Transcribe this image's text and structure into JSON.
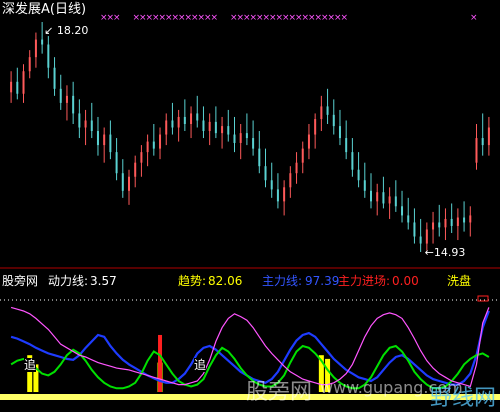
{
  "chart_data": {
    "type": "candlestick",
    "title": "深发展A(日线)",
    "price_high_label": "18.20",
    "price_low_label": "14.93",
    "price_high_marker": "↙",
    "price_low_marker": "←",
    "candles": [
      [
        17.2,
        17.5,
        17.05,
        17.35
      ],
      [
        17.35,
        17.55,
        17.1,
        17.18
      ],
      [
        17.18,
        17.6,
        17.05,
        17.5
      ],
      [
        17.5,
        17.8,
        17.4,
        17.7
      ],
      [
        17.7,
        18.05,
        17.55,
        17.95
      ],
      [
        17.95,
        18.2,
        17.75,
        17.88
      ],
      [
        17.88,
        18.0,
        17.4,
        17.55
      ],
      [
        17.55,
        17.7,
        17.15,
        17.25
      ],
      [
        17.25,
        17.45,
        16.95,
        17.05
      ],
      [
        17.05,
        17.3,
        16.8,
        17.15
      ],
      [
        17.15,
        17.35,
        16.75,
        16.9
      ],
      [
        16.9,
        17.1,
        16.55,
        16.7
      ],
      [
        16.7,
        16.95,
        16.45,
        16.8
      ],
      [
        16.8,
        17.05,
        16.55,
        16.65
      ],
      [
        16.65,
        16.85,
        16.3,
        16.45
      ],
      [
        16.45,
        16.7,
        16.2,
        16.6
      ],
      [
        16.6,
        16.8,
        16.25,
        16.35
      ],
      [
        16.35,
        16.55,
        15.95,
        16.05
      ],
      [
        16.05,
        16.25,
        15.7,
        15.8
      ],
      [
        15.8,
        16.1,
        15.6,
        16.0
      ],
      [
        16.0,
        16.3,
        15.85,
        16.2
      ],
      [
        16.2,
        16.45,
        16.0,
        16.35
      ],
      [
        16.35,
        16.6,
        16.15,
        16.5
      ],
      [
        16.5,
        16.75,
        16.3,
        16.4
      ],
      [
        16.4,
        16.7,
        16.25,
        16.6
      ],
      [
        16.6,
        16.9,
        16.45,
        16.8
      ],
      [
        16.8,
        17.05,
        16.6,
        16.7
      ],
      [
        16.7,
        16.95,
        16.5,
        16.85
      ],
      [
        16.85,
        17.1,
        16.65,
        16.75
      ],
      [
        16.75,
        17.0,
        16.55,
        16.9
      ],
      [
        16.9,
        17.15,
        16.7,
        16.8
      ],
      [
        16.8,
        17.0,
        16.55,
        16.65
      ],
      [
        16.65,
        16.9,
        16.45,
        16.78
      ],
      [
        16.78,
        17.0,
        16.55,
        16.62
      ],
      [
        16.62,
        16.85,
        16.4,
        16.72
      ],
      [
        16.72,
        16.95,
        16.5,
        16.6
      ],
      [
        16.6,
        16.85,
        16.35,
        16.48
      ],
      [
        16.48,
        16.75,
        16.25,
        16.62
      ],
      [
        16.62,
        16.9,
        16.45,
        16.55
      ],
      [
        16.55,
        16.8,
        16.3,
        16.4
      ],
      [
        16.4,
        16.65,
        16.05,
        16.15
      ],
      [
        16.15,
        16.4,
        15.85,
        15.95
      ],
      [
        15.95,
        16.2,
        15.7,
        15.82
      ],
      [
        15.82,
        16.05,
        15.55,
        15.65
      ],
      [
        15.65,
        15.95,
        15.45,
        15.85
      ],
      [
        15.85,
        16.15,
        15.7,
        16.05
      ],
      [
        16.05,
        16.35,
        15.9,
        16.2
      ],
      [
        16.2,
        16.5,
        16.05,
        16.4
      ],
      [
        16.4,
        16.75,
        16.25,
        16.6
      ],
      [
        16.6,
        16.9,
        16.4,
        16.82
      ],
      [
        16.82,
        17.15,
        16.65,
        17.0
      ],
      [
        17.0,
        17.25,
        16.75,
        16.88
      ],
      [
        16.88,
        17.1,
        16.6,
        16.72
      ],
      [
        16.72,
        16.95,
        16.45,
        16.55
      ],
      [
        16.55,
        16.8,
        16.25,
        16.35
      ],
      [
        16.35,
        16.55,
        16.0,
        16.1
      ],
      [
        16.1,
        16.35,
        15.85,
        15.95
      ],
      [
        15.95,
        16.2,
        15.7,
        15.8
      ],
      [
        15.8,
        16.05,
        15.55,
        15.65
      ],
      [
        15.65,
        15.9,
        15.45,
        15.78
      ],
      [
        15.78,
        16.0,
        15.55,
        15.62
      ],
      [
        15.62,
        15.85,
        15.4,
        15.72
      ],
      [
        15.72,
        15.95,
        15.5,
        15.58
      ],
      [
        15.58,
        15.8,
        15.35,
        15.45
      ],
      [
        15.45,
        15.7,
        15.25,
        15.35
      ],
      [
        15.35,
        15.55,
        15.05,
        15.15
      ],
      [
        15.15,
        15.4,
        14.93,
        15.05
      ],
      [
        15.05,
        15.35,
        14.95,
        15.25
      ],
      [
        15.25,
        15.5,
        15.05,
        15.35
      ],
      [
        15.35,
        15.6,
        15.15,
        15.28
      ],
      [
        15.28,
        15.55,
        15.1,
        15.4
      ],
      [
        15.4,
        15.62,
        15.2,
        15.3
      ],
      [
        15.3,
        15.55,
        15.1,
        15.42
      ],
      [
        15.42,
        15.65,
        15.22,
        15.35
      ],
      [
        15.35,
        15.58,
        15.15,
        15.45
      ],
      [
        16.2,
        16.75,
        16.1,
        16.55
      ],
      [
        16.55,
        16.9,
        16.3,
        16.45
      ],
      [
        16.45,
        16.85,
        16.3,
        16.7
      ]
    ],
    "indicator": {
      "site_label": "股旁网",
      "dynamic_label": "动力线:",
      "dynamic_value": "3.57",
      "trend_label": "趋势:",
      "trend_value": "82.06",
      "main_label": "主力线:",
      "main_value": "97.39",
      "entry_label": "主力进场:",
      "entry_value": "0.00",
      "wash_label": "洗盘",
      "zhui_marks": [
        "追",
        "追"
      ],
      "trend_values": [
        92,
        90,
        88,
        85,
        80,
        74,
        68,
        60,
        52,
        48,
        44,
        40,
        38,
        35,
        32,
        30,
        28,
        26,
        25,
        24,
        22,
        20,
        18,
        16,
        14,
        12,
        10,
        8,
        8,
        10,
        12,
        20,
        35,
        55,
        70,
        80,
        85,
        82,
        78,
        70,
        60,
        50,
        42,
        35,
        28,
        22,
        18,
        14,
        12,
        10,
        8,
        8,
        10,
        14,
        20,
        30,
        45,
        60,
        72,
        80,
        84,
        86,
        84,
        80,
        70,
        58,
        45,
        34,
        26,
        20,
        16,
        12,
        10,
        8,
        6,
        30,
        75,
        92
      ],
      "main_values": [
        60,
        58,
        55,
        52,
        48,
        45,
        42,
        40,
        38,
        36,
        35,
        40,
        48,
        55,
        62,
        60,
        50,
        42,
        35,
        30,
        26,
        22,
        18,
        15,
        12,
        10,
        10,
        14,
        20,
        30,
        42,
        48,
        50,
        46,
        40,
        34,
        28,
        22,
        18,
        14,
        12,
        10,
        14,
        22,
        34,
        46,
        56,
        62,
        64,
        60,
        52,
        44,
        36,
        30,
        24,
        20,
        16,
        14,
        12,
        16,
        24,
        32,
        38,
        40,
        36,
        30,
        24,
        18,
        14,
        12,
        10,
        8,
        8,
        12,
        20,
        40,
        70,
        88
      ],
      "dynamic_values": [
        30,
        34,
        36,
        32,
        26,
        20,
        18,
        22,
        30,
        40,
        46,
        42,
        34,
        24,
        16,
        10,
        6,
        4,
        4,
        6,
        10,
        20,
        34,
        44,
        40,
        30,
        20,
        12,
        8,
        6,
        8,
        14,
        28,
        40,
        48,
        44,
        36,
        26,
        18,
        12,
        8,
        6,
        6,
        10,
        18,
        32,
        44,
        50,
        48,
        42,
        34,
        24,
        16,
        10,
        6,
        4,
        4,
        8,
        16,
        28,
        40,
        48,
        50,
        44,
        34,
        22,
        14,
        8,
        4,
        4,
        6,
        12,
        20,
        30,
        36,
        40,
        42,
        38
      ],
      "entry_bars": [
        0,
        0,
        0,
        0,
        0,
        0,
        0,
        0,
        0,
        0,
        0,
        0,
        0,
        0,
        0,
        0,
        0,
        0,
        0,
        0,
        0,
        0,
        0,
        0,
        0,
        0,
        0,
        0,
        0,
        0,
        0,
        0,
        0,
        0,
        0,
        0,
        0,
        0,
        0,
        0,
        0,
        0,
        0,
        0,
        0,
        0,
        0,
        0,
        0,
        0,
        0,
        0,
        0,
        0,
        0,
        0,
        0,
        0,
        0,
        0,
        0,
        0,
        0,
        0,
        0,
        0,
        0,
        0,
        0,
        0,
        0,
        0,
        0,
        0,
        0,
        0,
        0,
        0
      ],
      "yellow_bars": [
        0,
        0,
        0,
        40,
        30,
        0,
        0,
        0,
        0,
        0,
        0,
        0,
        0,
        0,
        0,
        0,
        0,
        0,
        0,
        0,
        0,
        0,
        0,
        0,
        32,
        0,
        0,
        0,
        0,
        0,
        0,
        0,
        0,
        0,
        0,
        0,
        0,
        0,
        0,
        0,
        0,
        0,
        0,
        0,
        0,
        0,
        0,
        0,
        0,
        0,
        40,
        36,
        0,
        0,
        0,
        0,
        0,
        0,
        0,
        0,
        0,
        0,
        0,
        0,
        0,
        0,
        0,
        0,
        0,
        0,
        0,
        0,
        0,
        0,
        0,
        0,
        0,
        0
      ],
      "red_bars": [
        0,
        0,
        0,
        0,
        0,
        0,
        0,
        0,
        0,
        0,
        0,
        0,
        0,
        0,
        0,
        0,
        0,
        0,
        0,
        0,
        0,
        0,
        0,
        0,
        62,
        0,
        0,
        0,
        0,
        0,
        0,
        0,
        0,
        0,
        0,
        0,
        0,
        0,
        0,
        0,
        0,
        0,
        0,
        0,
        0,
        0,
        0,
        0,
        0,
        0,
        0,
        0,
        0,
        0,
        0,
        0,
        0,
        0,
        0,
        0,
        0,
        0,
        0,
        0,
        0,
        0,
        0,
        0,
        0,
        0,
        0,
        0,
        0,
        0,
        0,
        0,
        0,
        0
      ]
    }
  },
  "watermark": {
    "text1": "股旁网",
    "text2": "www.gupang.com",
    "text3": "野线网"
  },
  "colors": {
    "up": "#ff5a5a",
    "down": "#5ad2d2",
    "trend": "#ffff00",
    "main": "#1e3cff",
    "dynamic": "#00e000",
    "magenta": "#ff55ff",
    "red": "#ff2020"
  }
}
